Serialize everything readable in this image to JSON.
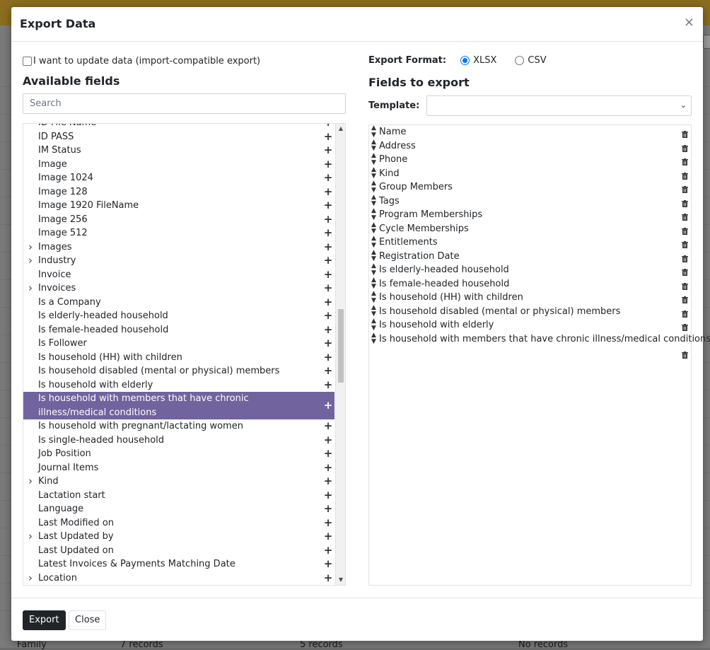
{
  "dialog": {
    "title": "Export Data",
    "close_glyph": "×"
  },
  "left": {
    "import_compat_label": "I want to update data (import-compatible export)",
    "available_title": "Available fields",
    "search_placeholder": "Search",
    "fields": [
      {
        "label": "ID File Name",
        "expandable": false,
        "highlighted": false
      },
      {
        "label": "ID PASS",
        "expandable": false,
        "highlighted": false
      },
      {
        "label": "IM Status",
        "expandable": false,
        "highlighted": false
      },
      {
        "label": "Image",
        "expandable": false,
        "highlighted": false
      },
      {
        "label": "Image 1024",
        "expandable": false,
        "highlighted": false
      },
      {
        "label": "Image 128",
        "expandable": false,
        "highlighted": false
      },
      {
        "label": "Image 1920 FileName",
        "expandable": false,
        "highlighted": false
      },
      {
        "label": "Image 256",
        "expandable": false,
        "highlighted": false
      },
      {
        "label": "Image 512",
        "expandable": false,
        "highlighted": false
      },
      {
        "label": "Images",
        "expandable": true,
        "highlighted": false
      },
      {
        "label": "Industry",
        "expandable": true,
        "highlighted": false
      },
      {
        "label": "Invoice",
        "expandable": false,
        "highlighted": false
      },
      {
        "label": "Invoices",
        "expandable": true,
        "highlighted": false
      },
      {
        "label": "Is a Company",
        "expandable": false,
        "highlighted": false
      },
      {
        "label": "Is elderly-headed household",
        "expandable": false,
        "highlighted": false
      },
      {
        "label": "Is female-headed household",
        "expandable": false,
        "highlighted": false
      },
      {
        "label": "Is Follower",
        "expandable": false,
        "highlighted": false
      },
      {
        "label": "Is household (HH) with children",
        "expandable": false,
        "highlighted": false
      },
      {
        "label": "Is household disabled (mental or physical) members",
        "expandable": false,
        "highlighted": false
      },
      {
        "label": "Is household with elderly",
        "expandable": false,
        "highlighted": false
      },
      {
        "label": "Is household with members that have chronic illness/medical conditions",
        "expandable": false,
        "highlighted": true
      },
      {
        "label": "Is household with pregnant/lactating women",
        "expandable": false,
        "highlighted": false
      },
      {
        "label": "Is single-headed household",
        "expandable": false,
        "highlighted": false
      },
      {
        "label": "Job Position",
        "expandable": false,
        "highlighted": false
      },
      {
        "label": "Journal Items",
        "expandable": false,
        "highlighted": false
      },
      {
        "label": "Kind",
        "expandable": true,
        "highlighted": false
      },
      {
        "label": "Lactation start",
        "expandable": false,
        "highlighted": false
      },
      {
        "label": "Language",
        "expandable": false,
        "highlighted": false
      },
      {
        "label": "Last Modified on",
        "expandable": false,
        "highlighted": false
      },
      {
        "label": "Last Updated by",
        "expandable": true,
        "highlighted": false
      },
      {
        "label": "Last Updated on",
        "expandable": false,
        "highlighted": false
      },
      {
        "label": "Latest Invoices & Payments Matching Date",
        "expandable": false,
        "highlighted": false
      },
      {
        "label": "Location",
        "expandable": true,
        "highlighted": false
      }
    ]
  },
  "right": {
    "format_label": "Export Format:",
    "format_options": [
      {
        "label": "XLSX",
        "selected": true
      },
      {
        "label": "CSV",
        "selected": false
      }
    ],
    "export_title": "Fields to export",
    "template_label": "Template:",
    "template_value": "",
    "export_fields": [
      "Name",
      "Address",
      "Phone",
      "Kind",
      "Group Members",
      "Tags",
      "Program Memberships",
      "Cycle Memberships",
      "Entitlements",
      "Registration Date",
      "Is elderly-headed household",
      "Is female-headed household",
      "Is household (HH) with children",
      "Is household disabled (mental or physical) members",
      "Is household with elderly",
      "Is household with members that have chronic illness/medical conditions"
    ]
  },
  "footer": {
    "export_label": "Export",
    "close_label": "Close"
  },
  "background": {
    "bottom_row": [
      "Family",
      "7 records",
      "5 records",
      "No records"
    ]
  },
  "icons": {
    "add": "plus-icon",
    "remove": "trash-icon",
    "reorder": "sort-icon",
    "expand": "chevron-right-icon"
  }
}
